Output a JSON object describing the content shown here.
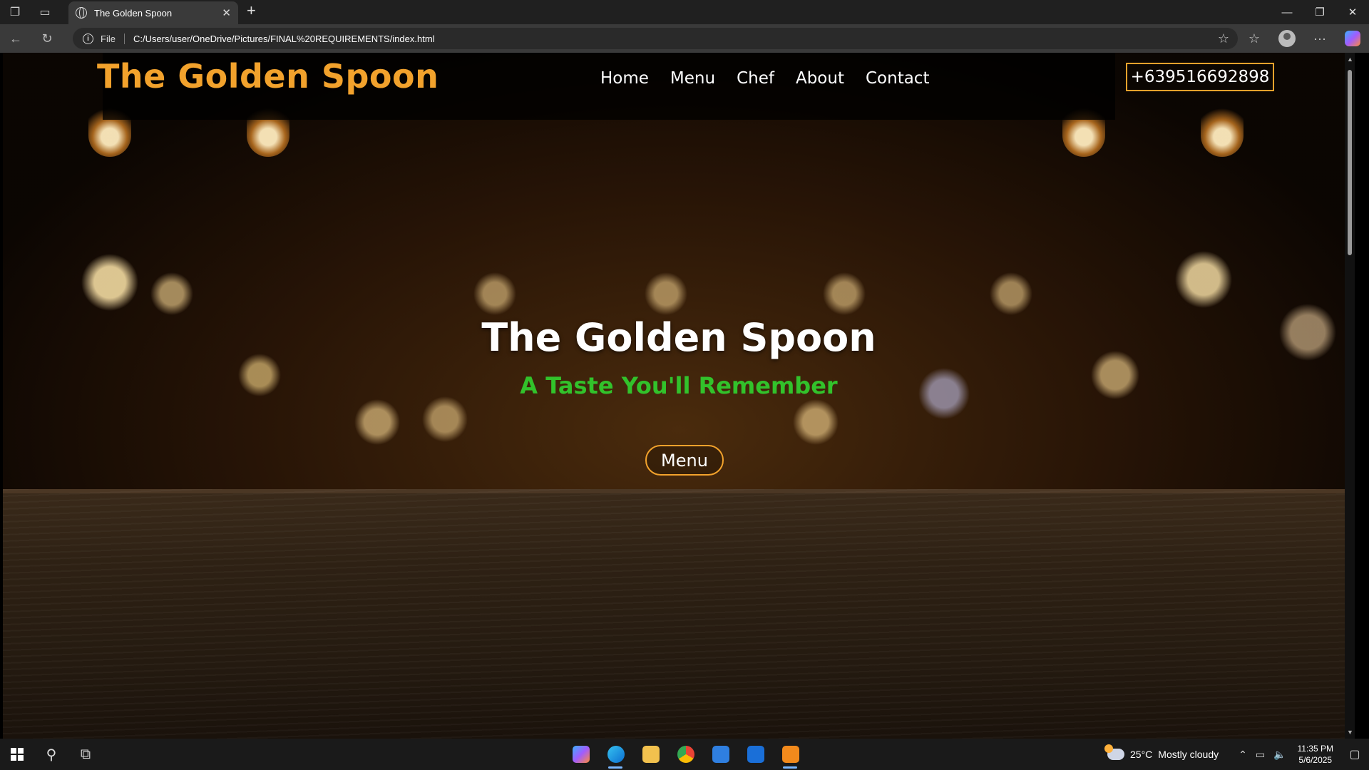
{
  "browser": {
    "tab_title": "The Golden Spoon",
    "address_scheme": "File",
    "address_url": "C:/Users/user/OneDrive/Pictures/FINAL%20REQUIREMENTS/index.html"
  },
  "site": {
    "logo": "The Golden Spoon",
    "nav": [
      "Home",
      "Menu",
      "Chef",
      "About",
      "Contact"
    ],
    "phone": "+639516692898",
    "hero_title": "The Golden Spoon",
    "hero_tagline": "A Taste You'll Remember",
    "hero_button": "Menu"
  },
  "taskbar": {
    "temperature": "25°C",
    "weather": "Mostly cloudy",
    "time": "11:35 PM",
    "date": "5/6/2025"
  },
  "colors": {
    "accent_gold": "#f2a22c",
    "tagline_green": "#32c22b",
    "chrome_dark": "#202020"
  },
  "icons": {
    "browser": [
      "workspaces-icon",
      "tab-actions-icon",
      "globe-icon",
      "close-icon",
      "plus-icon",
      "minimize-icon",
      "restore-icon",
      "window-close-icon",
      "back-icon",
      "refresh-icon",
      "info-icon",
      "favorite-star-icon",
      "favorites-icon",
      "profile-icon",
      "more-icon",
      "copilot-icon"
    ],
    "taskbar": [
      "windows-start-icon",
      "search-icon",
      "task-view-icon",
      "copilot-app-icon",
      "edge-app-icon",
      "file-explorer-icon",
      "chrome-app-icon",
      "store-app-icon",
      "outlook-app-icon",
      "sublime-app-icon",
      "weather-icon",
      "chevron-up-icon",
      "network-icon",
      "volume-icon",
      "notification-icon"
    ]
  }
}
